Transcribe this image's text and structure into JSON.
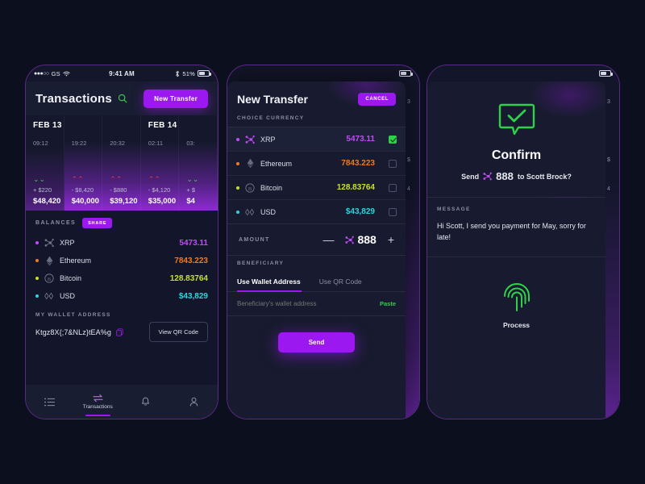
{
  "statusbar": {
    "carrier": "GS",
    "dots": "●●●○○",
    "time": "9:41 AM",
    "battery": "51%"
  },
  "colors": {
    "accent": "#9b18f0",
    "green": "#2fd04a",
    "xrp": "#c04cf5",
    "eth": "#f07a1e",
    "btc": "#c7e02b",
    "usd": "#2ad6e0",
    "red": "#e23b3b"
  },
  "phone1": {
    "title": "Transactions",
    "search_icon": "search-icon",
    "new_transfer_label": "New Transfer",
    "transactions": [
      {
        "day": "FEB 13",
        "time": "09:12",
        "direction": "down",
        "delta": "+ $220",
        "total": "$48,420",
        "light": true
      },
      {
        "day": "",
        "time": "19:22",
        "direction": "up",
        "delta": "- $8,420",
        "total": "$40,000",
        "light": false
      },
      {
        "day": "",
        "time": "20:32",
        "direction": "up",
        "delta": "- $880",
        "total": "$39,120",
        "light": false
      },
      {
        "day": "FEB 14",
        "time": "02:11",
        "direction": "up",
        "delta": "- $4,120",
        "total": "$35,000",
        "light": false
      },
      {
        "day": "",
        "time": "03:",
        "direction": "down",
        "delta": "+ $",
        "total": "$4",
        "light": false
      }
    ],
    "balances_label": "BALANCES",
    "share_label": "SHARE",
    "balances": [
      {
        "name": "XRP",
        "value": "5473.11",
        "color": "#c04cf5",
        "icon": "xrp-icon"
      },
      {
        "name": "Ethereum",
        "value": "7843.223",
        "color": "#f07a1e",
        "icon": "ethereum-icon"
      },
      {
        "name": "Bitcoin",
        "value": "128.83764",
        "color": "#c7e02b",
        "icon": "bitcoin-icon"
      },
      {
        "name": "USD",
        "value": "$43,829",
        "color": "#2ad6e0",
        "icon": "usd-icon"
      }
    ],
    "wallet_label": "MY WALLET ADDRESS",
    "wallet_address": "Ktgz8X{;7&NLz}tEA%g",
    "copy_icon": "copy-icon",
    "qr_button": "View QR Code",
    "tabs": [
      {
        "label": "",
        "icon": "list-icon",
        "active": false
      },
      {
        "label": "Transactions",
        "icon": "transfer-icon",
        "active": true
      },
      {
        "label": "",
        "icon": "bell-icon",
        "active": false
      },
      {
        "label": "",
        "icon": "person-icon",
        "active": false
      }
    ]
  },
  "phone2": {
    "title": "New Transfer",
    "cancel_label": "CANCEL",
    "choice_label": "CHOICE CURRENCY",
    "currencies": [
      {
        "name": "XRP",
        "value": "5473.11",
        "color": "#c04cf5",
        "checked": true,
        "icon": "xrp-icon"
      },
      {
        "name": "Ethereum",
        "value": "7843.223",
        "color": "#f07a1e",
        "checked": false,
        "icon": "ethereum-icon"
      },
      {
        "name": "Bitcoin",
        "value": "128.83764",
        "color": "#c7e02b",
        "checked": false,
        "icon": "bitcoin-icon"
      },
      {
        "name": "USD",
        "value": "$43,829",
        "color": "#2ad6e0",
        "checked": false,
        "icon": "usd-icon"
      }
    ],
    "amount_label": "AMOUNT",
    "amount_value": "888",
    "minus": "—",
    "plus": "+",
    "beneficiary_label": "BENEFICIARY",
    "tab_wallet": "Use Wallet Address",
    "tab_qr": "Use QR Code",
    "beneficiary_placeholder": "Beneficiary's wallet address",
    "beneficiary_value": "",
    "paste_label": "Paste",
    "send_label": "Send",
    "peek_values": [
      "3",
      "",
      "$",
      "4"
    ]
  },
  "phone3": {
    "check_icon": "check-bubble-icon",
    "title": "Confirm",
    "send_word": "Send",
    "amount": "888",
    "to_text": "to Scott Brock?",
    "message_label": "MESSAGE",
    "message_body": "Hi Scott, I send you payment for May, sorry for late!",
    "fingerprint_icon": "fingerprint-icon",
    "process_label": "Process",
    "peek_values": [
      "3",
      "",
      "$",
      "4"
    ]
  }
}
